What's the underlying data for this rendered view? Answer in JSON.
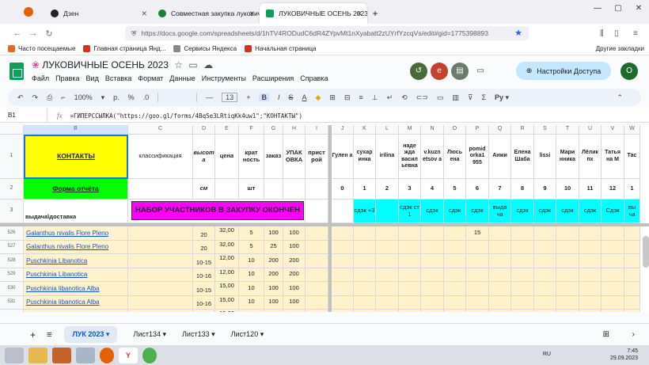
{
  "browser": {
    "tabs": [
      {
        "label": "Дзен",
        "color": "#222222"
      },
      {
        "label": "Совместная закупка луковичн",
        "color": "#1a7f37"
      },
      {
        "label": "ЛУКОВИЧНЫЕ ОСЕНЬ 2023",
        "color": "#0f9d58"
      }
    ],
    "new_tab": "+",
    "url": "https://docs.google.com/spreadsheets/d/1hTV4RODudC6dR4ZYpvMt1nXyabatt2zUYrfYzcqVs/edit#gid=1775398893",
    "bookmarks": [
      {
        "label": "Часто посещаемые",
        "color": "#e46a2a"
      },
      {
        "label": "Главная страница Янд...",
        "color": "#d93025"
      },
      {
        "label": "Сервисы Яндекса",
        "color": "#888888"
      },
      {
        "label": "Начальная страница",
        "color": "#d93025"
      }
    ],
    "bookmarks_right": "Другие закладки"
  },
  "sheets": {
    "title": "ЛУКОВИЧНЫЕ ОСЕНЬ 2023",
    "menus": [
      "Файл",
      "Правка",
      "Вид",
      "Вставка",
      "Формат",
      "Данные",
      "Инструменты",
      "Расширения",
      "Справка"
    ],
    "share_label": "Настройки Доступа",
    "user_initial": "О",
    "collab_initial": "e",
    "toolbar": {
      "zoom": "100%",
      "font_size": "13",
      "currency": "р.",
      "percent": "%",
      "decimals": ".0",
      "bold": "B"
    },
    "cell_ref": "B1",
    "formula": "=ГИПЕРССЫЛКА(\"https://goo.gl/forms/4BqSe3LRtiqKk4uw1\";\"КОНТАКТЫ\")",
    "fx": "fx",
    "sheet_tabs": [
      "ЛУК 2023",
      "Лист134",
      "Лист133",
      "Лист120"
    ],
    "add_sheet": "+",
    "all_sheets": "≡"
  },
  "grid": {
    "col_letters": [
      "B",
      "C",
      "D",
      "E",
      "F",
      "G",
      "H",
      "I",
      "J",
      "K",
      "L",
      "M",
      "N",
      "O",
      "P",
      "Q",
      "R",
      "S",
      "T",
      "U",
      "V",
      "W"
    ],
    "row1": {
      "rownum": "1",
      "B": "КОНТАКТЫ",
      "C": "классификация",
      "D": "высот а",
      "E": "цена",
      "F": "крат ность",
      "G": "заказ",
      "H": "УПАК ОВКА",
      "I": "прист рой",
      "members": [
        "Гулен а",
        "сухар инка",
        "irilina",
        "наде жда васил ьевна",
        "v.kuzn etsov a",
        "Люсь ена",
        "pomid orka1 955",
        "Анжи",
        "Елена Шаба",
        "lissi",
        "Мари нника",
        "Лёлик пх",
        "Татья на М",
        "Тас"
      ]
    },
    "row2": {
      "rownum": "2",
      "B": "Форма отчёта",
      "D": "см",
      "F": "шт",
      "numbers": [
        "0",
        "1",
        "2",
        "3",
        "4",
        "5",
        "6",
        "7",
        "8",
        "9",
        "10",
        "11",
        "12",
        "1"
      ]
    },
    "row3": {
      "rownum": "3",
      "B": "выдача\\доставка",
      "banner": "НАБОР УЧАСТНИКОВ В ЗАКУПКУ ОКОНЧЕН",
      "delivery": [
        "",
        "сдэк +3",
        "",
        "сдэк ст 1",
        "сдэк",
        "сдэк",
        "сдэк",
        "выда ча",
        "сдэк",
        "сдэк",
        "сдэк",
        "сдэк",
        "Сдэк",
        "вы ча"
      ]
    },
    "data_rows": [
      {
        "n": "526",
        "name": "Galanthus nivalis Flore Pleno",
        "h": "20",
        "price": "32,00",
        "k": "5",
        "order": "100",
        "pack": "100",
        "extra": {
          "P": "15"
        }
      },
      {
        "n": "527",
        "name": "Galanthus nivalis Flore Pleno",
        "h": "20",
        "price": "32,00",
        "k": "5",
        "order": "25",
        "pack": "100",
        "extra": {}
      },
      {
        "n": "528",
        "name": "Puschkinia Libanotica",
        "h": "10-15",
        "price": "12,00",
        "k": "10",
        "order": "200",
        "pack": "200",
        "extra": {}
      },
      {
        "n": "529",
        "name": "Puschkinia Libanotica",
        "h": "10-16",
        "price": "12,00",
        "k": "10",
        "order": "200",
        "pack": "200",
        "extra": {}
      },
      {
        "n": "530",
        "name": "Puschkinia libanotica Alba",
        "h": "10-15",
        "price": "15,00",
        "k": "10",
        "order": "100",
        "pack": "100",
        "extra": {}
      },
      {
        "n": "531",
        "name": "Puschkinia libanotica Alba",
        "h": "10-16",
        "price": "15,00",
        "k": "10",
        "order": "100",
        "pack": "100",
        "extra": {}
      },
      {
        "n": "532",
        "name": "Puschkinia libanotica Alba",
        "h": "",
        "price": "15,00",
        "k": "",
        "order": "",
        "pack": "",
        "extra": {}
      }
    ]
  },
  "taskbar": {
    "lang": "RU",
    "time": "7:45",
    "date": "29.09.2023"
  },
  "colors": {
    "yellow": "#ffff00",
    "green": "#00ff00",
    "magenta": "#ff00ff",
    "cyan": "#00ffff",
    "rowbg": "#fff2cc"
  }
}
